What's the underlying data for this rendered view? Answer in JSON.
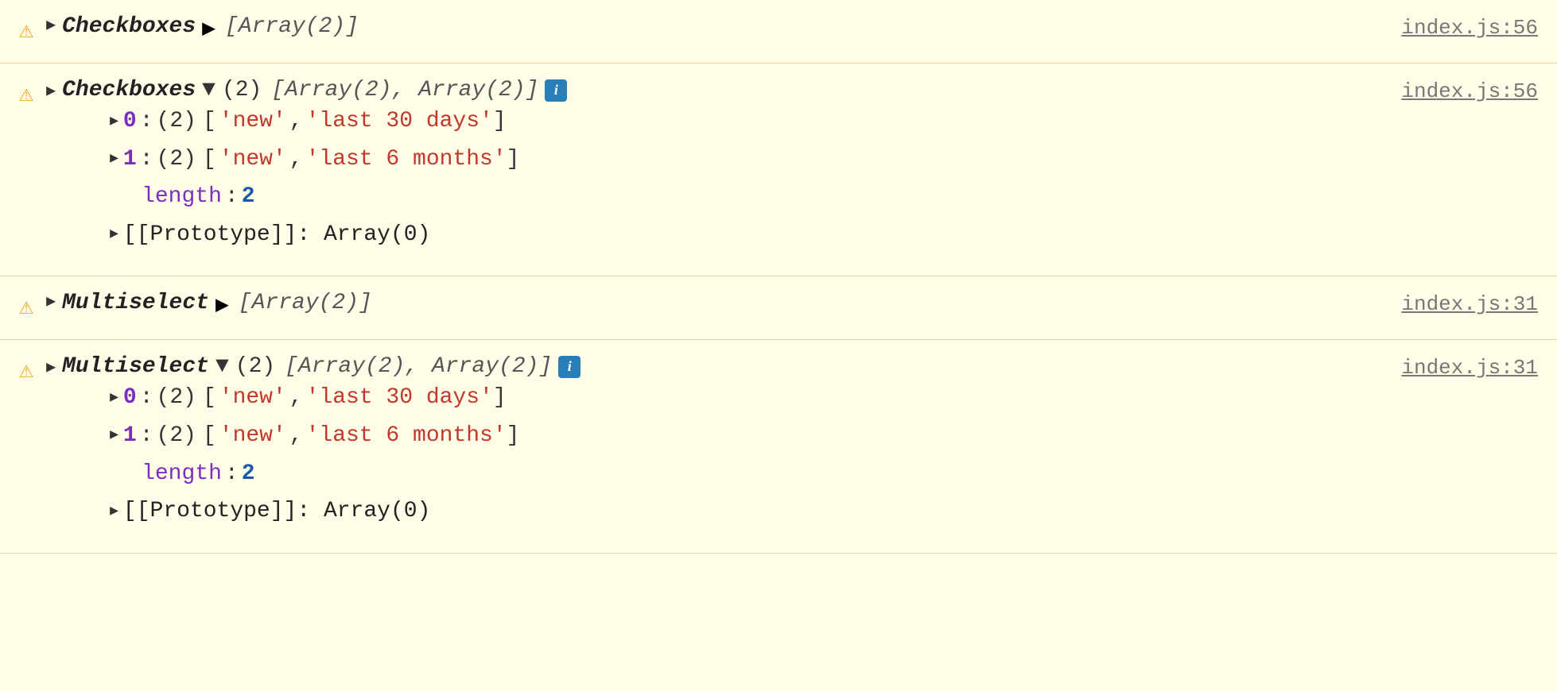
{
  "console": {
    "blocks": [
      {
        "id": "checkboxes-collapsed",
        "warning_icon": "⚠",
        "arrow": "▶",
        "label": "Checkboxes",
        "arrow2": "▶",
        "array_preview": "[Array(2)]",
        "file_link": "index.js:56"
      },
      {
        "id": "checkboxes-expanded",
        "warning_icon": "⚠",
        "arrow": "▶",
        "label": "Checkboxes",
        "arrow2": "▼",
        "count": "(2)",
        "array_preview": "[Array(2), Array(2)]",
        "has_info": true,
        "file_link": "index.js:56",
        "items": [
          {
            "index": "0",
            "count": "(2)",
            "values": [
              "'new'",
              "'last 30 days'"
            ]
          },
          {
            "index": "1",
            "count": "(2)",
            "values": [
              "'new'",
              "'last 6 months'"
            ]
          }
        ],
        "length_label": "length",
        "length_value": "2",
        "prototype_text": "[[Prototype]]: Array(0)"
      }
    ],
    "multiselect_blocks": [
      {
        "id": "multiselect-collapsed",
        "warning_icon": "⚠",
        "arrow": "▶",
        "label": "Multiselect",
        "arrow2": "▶",
        "array_preview": "[Array(2)]",
        "file_link": "index.js:31"
      },
      {
        "id": "multiselect-expanded",
        "warning_icon": "⚠",
        "arrow": "▶",
        "label": "Multiselect",
        "arrow2": "▼",
        "count": "(2)",
        "array_preview": "[Array(2), Array(2)]",
        "has_info": true,
        "file_link": "index.js:31",
        "items": [
          {
            "index": "0",
            "count": "(2)",
            "values": [
              "'new'",
              "'last 30 days'"
            ]
          },
          {
            "index": "1",
            "count": "(2)",
            "values": [
              "'new'",
              "'last 6 months'"
            ]
          }
        ],
        "length_label": "length",
        "length_value": "2",
        "prototype_text": "[[Prototype]]: Array(0)"
      }
    ]
  }
}
